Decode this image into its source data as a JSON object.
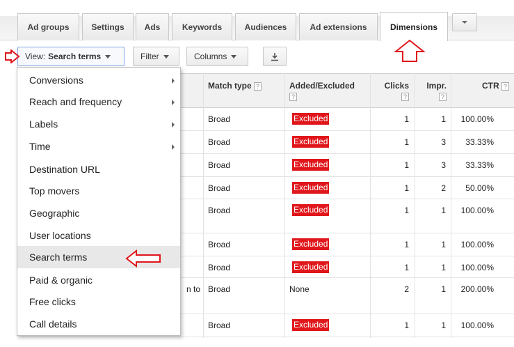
{
  "tabs": [
    {
      "label": "Ad groups",
      "active": false
    },
    {
      "label": "Settings",
      "active": false
    },
    {
      "label": "Ads",
      "active": false
    },
    {
      "label": "Keywords",
      "active": false
    },
    {
      "label": "Audiences",
      "active": false
    },
    {
      "label": "Ad extensions",
      "active": false
    },
    {
      "label": "Dimensions",
      "active": true
    }
  ],
  "tab_more_icon": "chevron-down-icon",
  "toolbar": {
    "view_prefix": "View:",
    "view_value": "Search terms",
    "filter_label": "Filter",
    "columns_label": "Columns",
    "download_icon": "download-icon"
  },
  "table": {
    "headers": {
      "match_type": "Match type",
      "added_excluded": "Added/Excluded",
      "clicks": "Clicks",
      "impr": "Impr.",
      "ctr": "CTR",
      "help": "?"
    },
    "rows": [
      {
        "partial": "",
        "match_type": "Broad",
        "status": "Excluded",
        "clicks": "1",
        "impr": "1",
        "ctr": "100.00%"
      },
      {
        "partial": "",
        "match_type": "Broad",
        "status": "Excluded",
        "clicks": "1",
        "impr": "3",
        "ctr": "33.33%"
      },
      {
        "partial": "",
        "match_type": "Broad",
        "status": "Excluded",
        "clicks": "1",
        "impr": "3",
        "ctr": "33.33%"
      },
      {
        "partial": "",
        "match_type": "Broad",
        "status": "Excluded",
        "clicks": "1",
        "impr": "2",
        "ctr": "50.00%"
      },
      {
        "partial": "",
        "match_type": "Broad",
        "status": "Excluded",
        "clicks": "1",
        "impr": "1",
        "ctr": "100.00%"
      },
      {
        "partial": "",
        "match_type": "Broad",
        "status": "Excluded",
        "clicks": "1",
        "impr": "1",
        "ctr": "100.00%"
      },
      {
        "partial": "",
        "match_type": "Broad",
        "status": "Excluded",
        "clicks": "1",
        "impr": "1",
        "ctr": "100.00%"
      },
      {
        "partial": "n to",
        "match_type": "Broad",
        "status": "None",
        "clicks": "2",
        "impr": "1",
        "ctr": "200.00%"
      },
      {
        "partial": "",
        "match_type": "Broad",
        "status": "Excluded",
        "clicks": "1",
        "impr": "1",
        "ctr": "100.00%"
      }
    ]
  },
  "menu": {
    "items": [
      {
        "label": "Conversions",
        "submenu": true
      },
      {
        "label": "Reach and frequency",
        "submenu": true
      },
      {
        "label": "Labels",
        "submenu": true
      },
      {
        "label": "Time",
        "submenu": true
      },
      {
        "label": "Destination URL",
        "submenu": false
      },
      {
        "label": "Top movers",
        "submenu": false
      },
      {
        "label": "Geographic",
        "submenu": false
      },
      {
        "label": "User locations",
        "submenu": false
      },
      {
        "label": "Search terms",
        "submenu": false,
        "highlighted": true
      },
      {
        "label": "Paid & organic",
        "submenu": false
      },
      {
        "label": "Free clicks",
        "submenu": false
      },
      {
        "label": "Call details",
        "submenu": false
      }
    ]
  },
  "colors": {
    "excluded_badge": "#e0161b",
    "annotation_arrow": "#e0161b",
    "view_button_border": "#7fa6e3"
  }
}
